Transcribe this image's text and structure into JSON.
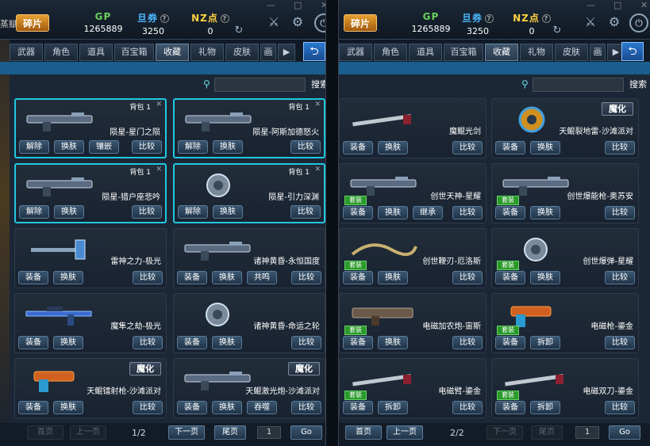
{
  "left": {
    "edge_text": "蒸赋",
    "logo": "碎片",
    "stats": {
      "gp": {
        "label": "GP",
        "value": "1265889"
      },
      "ye": {
        "label": "旦券",
        "value": "3250"
      },
      "nz": {
        "label": "NZ点",
        "value": "0"
      }
    },
    "tabs": [
      "武器",
      "角色",
      "道具",
      "百宝箱",
      "收藏",
      "礼物",
      "皮肤",
      "画"
    ],
    "active_tab": "收藏",
    "search_button": "搜索",
    "cards": [
      {
        "name": "陨星-星门之陨",
        "bag": "背包 1",
        "buttons": [
          "解除",
          "换肤",
          "镶嵌"
        ],
        "compare": "比较",
        "selected": true,
        "icon": "rifle-icon"
      },
      {
        "name": "陨星-阿斯加德怒火",
        "bag": "背包 1",
        "buttons": [
          "解除",
          "换肤"
        ],
        "compare": "比较",
        "selected": true,
        "icon": "rifle-icon"
      },
      {
        "name": "陨星-猎户座悲吟",
        "bag": "背包 1",
        "buttons": [
          "解除",
          "换肤"
        ],
        "compare": "比较",
        "selected": true,
        "icon": "rifle-icon"
      },
      {
        "name": "陨星-引力深渊",
        "bag": "背包 1",
        "buttons": [
          "解除",
          "换肤"
        ],
        "compare": "比较",
        "selected": true,
        "icon": "grenade-icon"
      },
      {
        "name": "雷神之力-极光",
        "buttons": [
          "装备",
          "换肤"
        ],
        "compare": "比较",
        "icon": "hammer-icon"
      },
      {
        "name": "诸神黄昏-永恒国度",
        "buttons": [
          "装备",
          "换肤",
          "共鸣"
        ],
        "compare": "比较",
        "icon": "rifle-icon"
      },
      {
        "name": "魔隼之劫-极光",
        "buttons": [
          "装备",
          "换肤"
        ],
        "compare": "比较",
        "icon": "sniper-icon"
      },
      {
        "name": "诸神黄昏-命运之轮",
        "buttons": [
          "装备",
          "换肤"
        ],
        "compare": "比较",
        "icon": "grenade-icon"
      },
      {
        "name": "天鲲镭射枪-沙滩派对",
        "tag": "魔化",
        "buttons": [
          "装备",
          "换肤"
        ],
        "compare": "比较",
        "icon": "pistol-icon"
      },
      {
        "name": "天鲲激光炮-沙滩派对",
        "tag": "魔化",
        "buttons": [
          "装备",
          "换肤",
          "吞噬"
        ],
        "compare": "比较",
        "icon": "rifle-icon"
      }
    ],
    "pager": {
      "first": "首页",
      "prev": "上一页",
      "page": "1/2",
      "next": "下一页",
      "last": "尾页",
      "input": "1",
      "go": "Go"
    }
  },
  "right": {
    "logo": "碎片",
    "stats": {
      "gp": {
        "label": "GP",
        "value": "1265889"
      },
      "ye": {
        "label": "旦券",
        "value": "3250"
      },
      "nz": {
        "label": "NZ点",
        "value": "0"
      }
    },
    "tabs": [
      "武器",
      "角色",
      "道具",
      "百宝箱",
      "收藏",
      "礼物",
      "皮肤",
      "画"
    ],
    "active_tab": "收藏",
    "search_button": "搜索",
    "cards": [
      {
        "name": "魔鲲光剑",
        "buttons": [
          "装备",
          "换肤"
        ],
        "compare": "比较",
        "icon": "sword-icon"
      },
      {
        "name": "天鲲裂地雷-沙滩派对",
        "tag": "魔化",
        "buttons": [
          "装备",
          "换肤"
        ],
        "compare": "比较",
        "icon": "mine-icon"
      },
      {
        "name": "创世天神-星耀",
        "green": "套装",
        "buttons": [
          "装备",
          "换肤",
          "继承"
        ],
        "compare": "比较",
        "icon": "rifle-icon"
      },
      {
        "name": "创世爆能枪-奥苏安",
        "green": "套装",
        "buttons": [
          "装备",
          "换肤"
        ],
        "compare": "比较",
        "icon": "rifle-icon"
      },
      {
        "name": "创世鞭刃-厄洛斯",
        "green": "套装",
        "buttons": [
          "装备",
          "换肤"
        ],
        "compare": "比较",
        "icon": "whip-icon"
      },
      {
        "name": "创世爆弹-星耀",
        "green": "套装",
        "buttons": [
          "装备",
          "换肤"
        ],
        "compare": "比较",
        "icon": "grenade-icon"
      },
      {
        "name": "电磁加农炮-宙斯",
        "green": "套装",
        "buttons": [
          "装备",
          "换肤"
        ],
        "compare": "比较",
        "icon": "cannon-icon"
      },
      {
        "name": "电磁枪-鎏金",
        "green": "套装",
        "buttons": [
          "装备",
          "拆卸"
        ],
        "compare": "比较",
        "icon": "pistol-icon"
      },
      {
        "name": "电磁臂-鎏金",
        "green": "套装",
        "buttons": [
          "装备",
          "拆卸"
        ],
        "compare": "比较",
        "icon": "melee-icon"
      },
      {
        "name": "电磁双刀-鎏金",
        "green": "套装",
        "buttons": [
          "装备",
          "拆卸"
        ],
        "compare": "比较",
        "icon": "blade-icon"
      }
    ],
    "pager": {
      "first": "首页",
      "prev": "上一页",
      "page": "2/2",
      "next": "下一页",
      "last": "尾页",
      "input": "1",
      "go": "Go"
    }
  }
}
